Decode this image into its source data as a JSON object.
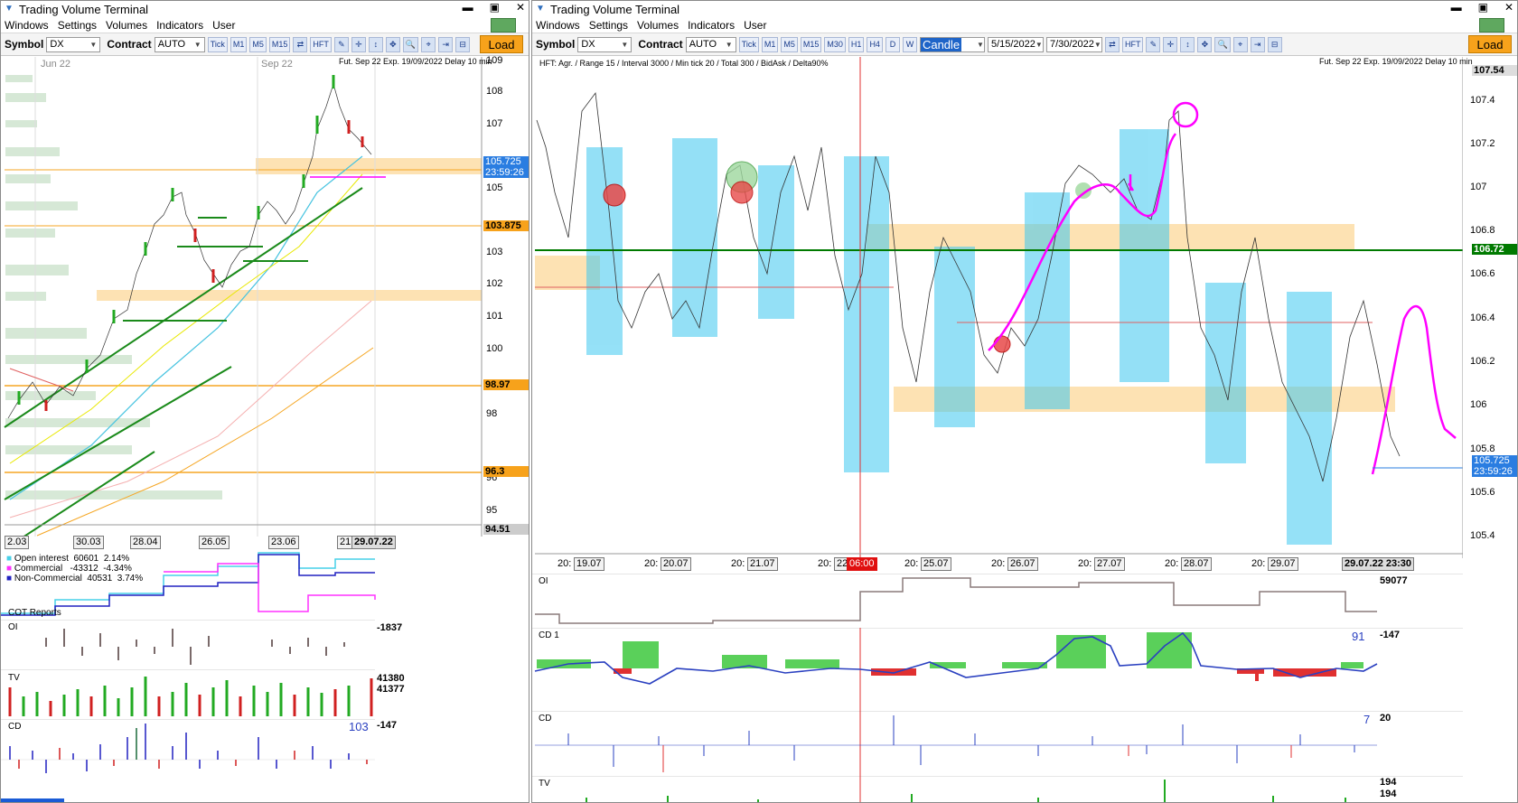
{
  "left": {
    "title": "Trading Volume Terminal",
    "menu": [
      "Windows",
      "Settings",
      "Volumes",
      "Indicators",
      "User"
    ],
    "toolbar": {
      "symbol_label": "Symbol",
      "symbol_value": "DX",
      "contract_label": "Contract",
      "contract_value": "AUTO",
      "buttons": [
        "Tick",
        "M1",
        "M5",
        "M15",
        "N",
        "HFT"
      ],
      "load_label": "Load"
    },
    "chart": {
      "info": "Fut. Sep 22 Exp. 19/09/2022 Delay 10 min",
      "top_months": [
        "Jun 22",
        "Sep 22"
      ],
      "y_ticks": [
        "109",
        "108",
        "107",
        "106",
        "105",
        "104",
        "103",
        "102",
        "101",
        "100",
        "99",
        "98",
        "97",
        "96",
        "95"
      ],
      "price_current": "105.725",
      "price_timer": "23:59:26",
      "level_1": "103.875",
      "level_2": "98.97",
      "level_3": "96.3",
      "level_min": "94.51",
      "x_dates": [
        "2.03",
        "30.03",
        "28.04",
        "26.05",
        "23.06",
        "21"
      ],
      "current_date": "29.07.22"
    },
    "cot": {
      "open_interest_label": "Open interest",
      "open_interest_value": "60601",
      "open_interest_pct": "2.14%",
      "commercial_label": "Commercial",
      "commercial_value": "-43312",
      "commercial_pct": "-4.34%",
      "noncommercial_label": "Non-Commercial",
      "noncommercial_value": "40531",
      "noncommercial_pct": "3.74%",
      "title": "COT Reports"
    },
    "oi_panel": {
      "label": "OI",
      "value": "-1837"
    },
    "tv_panel": {
      "label": "TV",
      "value1": "41380",
      "value2": "41377"
    },
    "cd_panel": {
      "label": "CD",
      "value": "103",
      "value2": "-147"
    }
  },
  "right": {
    "title": "Trading Volume Terminal",
    "menu": [
      "Windows",
      "Settings",
      "Volumes",
      "Indicators",
      "User"
    ],
    "toolbar": {
      "symbol_label": "Symbol",
      "symbol_value": "DX",
      "contract_label": "Contract",
      "contract_value": "AUTO",
      "buttons": [
        "Tick",
        "M1",
        "M5",
        "M15",
        "M30",
        "H1",
        "H4",
        "D",
        "W"
      ],
      "chart_type": "Candle",
      "date_from": "5/15/2022",
      "date_to": "7/30/2022",
      "hft_label": "HFT",
      "load_label": "Load"
    },
    "chart": {
      "info_left": "HFT: Agr. / Range 15 / Interval 3000 / Min tick 20 / Total 300 / BidAsk / Delta90%",
      "info_right": "Fut. Sep 22 Exp. 19/09/2022 Delay 10 min",
      "y_ticks": [
        "107.4",
        "107.2",
        "107",
        "106.8",
        "106.6",
        "106.4",
        "106.2",
        "106",
        "105.8",
        "105.6",
        "105.4"
      ],
      "price_top": "107.54",
      "price_green": "106.72",
      "price_current": "105.725",
      "price_timer": "23:59:26",
      "x_dates": [
        "19.07",
        "20.07",
        "21.07",
        "22",
        "25.07",
        "26.07",
        "27.07",
        "28.07",
        "29.07"
      ],
      "x_prefix": "20:",
      "cursor_time": "06:00",
      "current_date": "29.07.22 23:30"
    },
    "oi_panel": {
      "label": "OI",
      "value": "59077"
    },
    "cd1_panel": {
      "label": "CD 1",
      "value": "91",
      "value2": "-147"
    },
    "cd_panel": {
      "label": "CD",
      "value": "7",
      "value2": "20"
    },
    "tv_panel": {
      "label": "TV",
      "value1": "194",
      "value2": "194"
    }
  },
  "colors": {
    "orange_zone": "#fde2b3",
    "green_line": "#007a00",
    "magenta": "#ff00ff",
    "cyan_profile": "#3ec8f0",
    "price_box_blue": "#2a7de1",
    "orange_label": "#f7a21b"
  }
}
